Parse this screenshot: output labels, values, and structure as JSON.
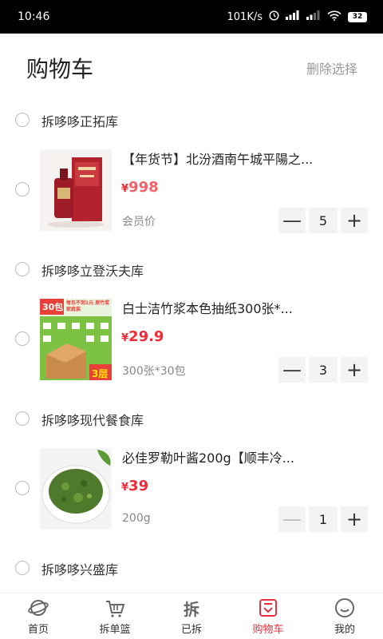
{
  "status": {
    "time": "10:46",
    "speed": "101K/s",
    "battery": "32"
  },
  "header": {
    "title": "购物车",
    "delete_label": "删除选择"
  },
  "stores": [
    {
      "name": "拆哆哆正拓库",
      "item": {
        "name": "【年货节】北汾酒南午城平陽之...",
        "yen": "¥",
        "price": "998",
        "spec": "会员价",
        "qty": "5"
      }
    },
    {
      "name": "拆哆哆立登沃夫库",
      "item": {
        "name": "白士洁竹浆本色抽纸300张*...",
        "yen": "¥",
        "price": "29.9",
        "spec": "300张*30包",
        "qty": "3",
        "thumb_text": {
          "packs": "30包",
          "layers": "3层",
          "banner": "每包不到1元 原竹浆家庭装"
        }
      }
    },
    {
      "name": "拆哆哆现代餐食库",
      "item": {
        "name": "必佳罗勒叶酱200g【顺丰冷...",
        "yen": "¥",
        "price": "39",
        "spec": "200g",
        "qty": "1"
      }
    },
    {
      "name": "拆哆哆兴盛库"
    }
  ],
  "stepper": {
    "minus": "—",
    "plus": "+"
  },
  "tabs": [
    {
      "label": "首页",
      "icon": "planet-icon"
    },
    {
      "label": "拆单篮",
      "icon": "basket-icon"
    },
    {
      "label": "已拆",
      "icon": "chai-icon",
      "glyph": "拆"
    },
    {
      "label": "购物车",
      "icon": "cart-icon",
      "active": true
    },
    {
      "label": "我的",
      "icon": "smiley-icon"
    }
  ],
  "colors": {
    "accent": "#e8303e",
    "price": "#f02b37",
    "muted": "#999999"
  }
}
